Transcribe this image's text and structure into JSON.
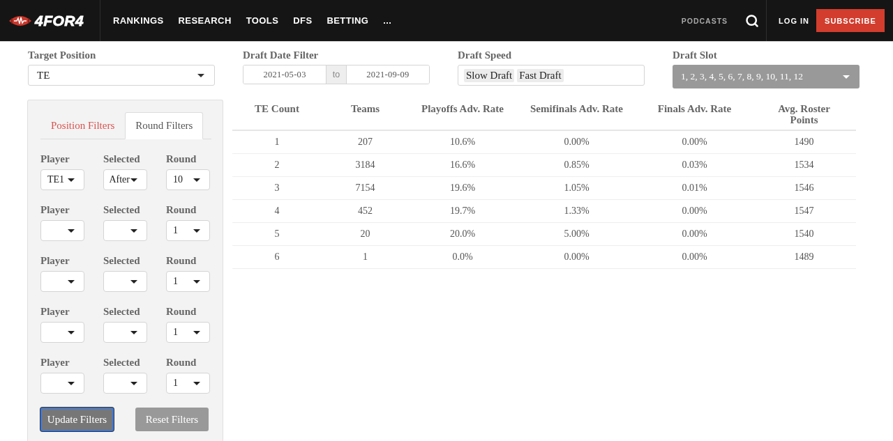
{
  "header": {
    "logo": "4FOR4",
    "nav": [
      "RANKINGS",
      "RESEARCH",
      "TOOLS",
      "DFS",
      "BETTING",
      "..."
    ],
    "podcasts": "PODCASTS",
    "login": "LOG IN",
    "subscribe": "SUBSCRIBE"
  },
  "filters": {
    "target_position": {
      "label": "Target Position",
      "value": "TE"
    },
    "draft_date": {
      "label": "Draft Date Filter",
      "from": "2021-05-03",
      "separator": "to",
      "to": "2021-09-09"
    },
    "draft_speed": {
      "label": "Draft Speed",
      "tags": [
        "Slow Draft",
        "Fast Draft"
      ]
    },
    "draft_slot": {
      "label": "Draft Slot",
      "value": "1, 2, 3, 4, 5, 6, 7, 8, 9, 10, 11, 12"
    }
  },
  "panel": {
    "tabs": [
      {
        "label": "Position Filters",
        "selected": false
      },
      {
        "label": "Round Filters",
        "selected": true
      }
    ],
    "rows": [
      {
        "fields": [
          {
            "label": "Player",
            "value": "TE1"
          },
          {
            "label": "Selected",
            "value": "After"
          },
          {
            "label": "Round",
            "value": "10"
          }
        ]
      },
      {
        "fields": [
          {
            "label": "Player"
          },
          {
            "label": "Selected"
          },
          {
            "label": "Round",
            "value": "1"
          }
        ]
      },
      {
        "fields": [
          {
            "label": "Player"
          },
          {
            "label": "Selected"
          },
          {
            "label": "Round",
            "value": "1"
          }
        ]
      },
      {
        "fields": [
          {
            "label": "Player"
          },
          {
            "label": "Selected"
          },
          {
            "label": "Round",
            "value": "1"
          }
        ]
      },
      {
        "fields": [
          {
            "label": "Player"
          },
          {
            "label": "Selected"
          },
          {
            "label": "Round",
            "value": "1"
          }
        ]
      }
    ],
    "buttons": [
      {
        "label": "Update Filters",
        "focused": true
      },
      {
        "label": "Reset Filters",
        "focused": false
      }
    ]
  },
  "table": {
    "columns": [
      "TE Count",
      "Teams",
      "Playoffs Adv. Rate",
      "Semifinals Adv. Rate",
      "Finals Adv. Rate",
      "Avg. Roster Points"
    ],
    "rows": [
      [
        "1",
        "207",
        "10.6%",
        "0.00%",
        "0.00%",
        "1490"
      ],
      [
        "2",
        "3184",
        "16.6%",
        "0.85%",
        "0.03%",
        "1534"
      ],
      [
        "3",
        "7154",
        "19.6%",
        "1.05%",
        "0.01%",
        "1546"
      ],
      [
        "4",
        "452",
        "19.7%",
        "1.33%",
        "0.00%",
        "1547"
      ],
      [
        "5",
        "20",
        "20.0%",
        "5.00%",
        "0.00%",
        "1540"
      ],
      [
        "6",
        "1",
        "0.0%",
        "0.00%",
        "0.00%",
        "1489"
      ]
    ]
  }
}
